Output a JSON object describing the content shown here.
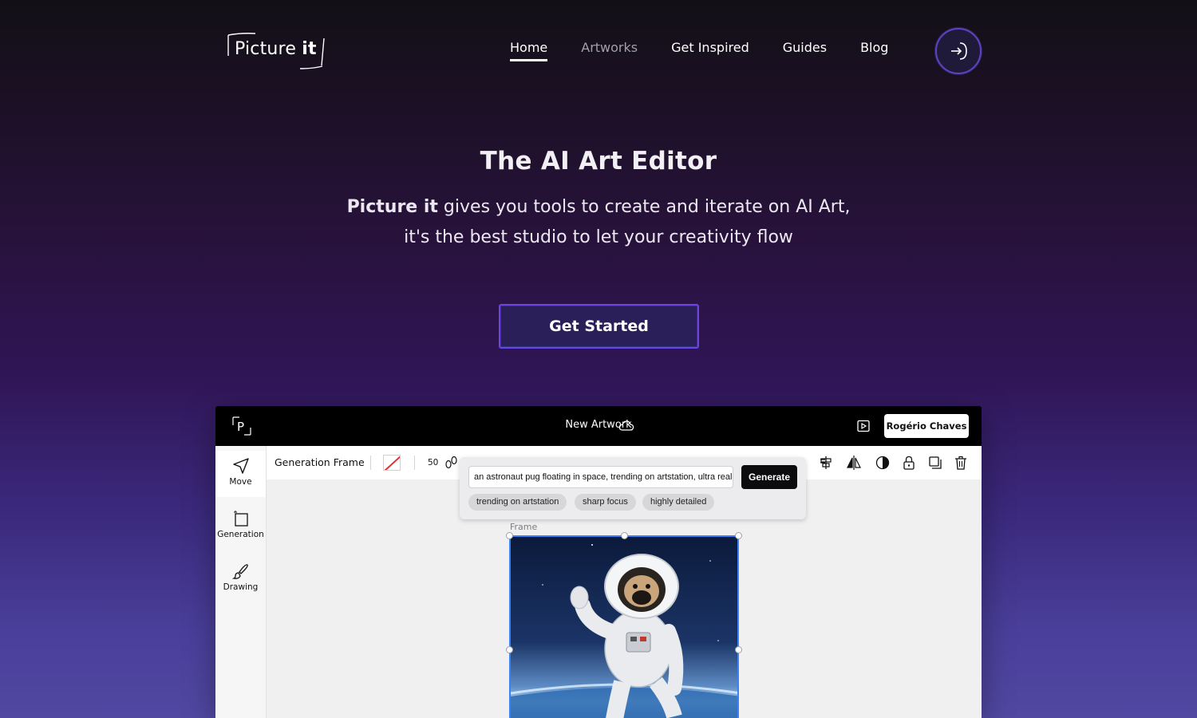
{
  "nav": {
    "logo_text_regular": "Picture",
    "logo_text_bold": "it",
    "links": [
      {
        "label": "Home",
        "state": "active"
      },
      {
        "label": "Artworks",
        "state": "dim"
      },
      {
        "label": "Get Inspired",
        "state": "normal"
      },
      {
        "label": "Guides",
        "state": "normal"
      },
      {
        "label": "Blog",
        "state": "normal"
      }
    ],
    "login_icon": "login-arrow-icon"
  },
  "hero": {
    "title": "The AI Art Editor",
    "subtitle_brand": "Picture it",
    "subtitle_line1_rest": " gives you tools to create and iterate on AI Art,",
    "subtitle_line2": "it's the best studio to let your creativity flow",
    "cta_label": "Get Started"
  },
  "app": {
    "logo_letter": "P",
    "title": "New Artwork",
    "user_name": "Rogério Chaves",
    "tools": [
      {
        "label": "Move",
        "icon": "cursor-arrow-icon",
        "active": true
      },
      {
        "label": "Generation",
        "icon": "frame-icon",
        "active": false
      },
      {
        "label": "Drawing",
        "icon": "brush-icon",
        "active": false
      }
    ],
    "toolbar": {
      "label": "Generation Frame",
      "number": "50"
    },
    "prompt": {
      "value": "an astronaut pug floating in space, trending on artstation, ultra realistic",
      "generate_label": "Generate",
      "chips": [
        "trending on artstation",
        "sharp focus",
        "highly detailed"
      ]
    },
    "frame_label": "Frame"
  },
  "colors": {
    "accent_purple": "#6c43e4",
    "selection_blue": "#3b82f6",
    "app_bar": "#000000"
  }
}
